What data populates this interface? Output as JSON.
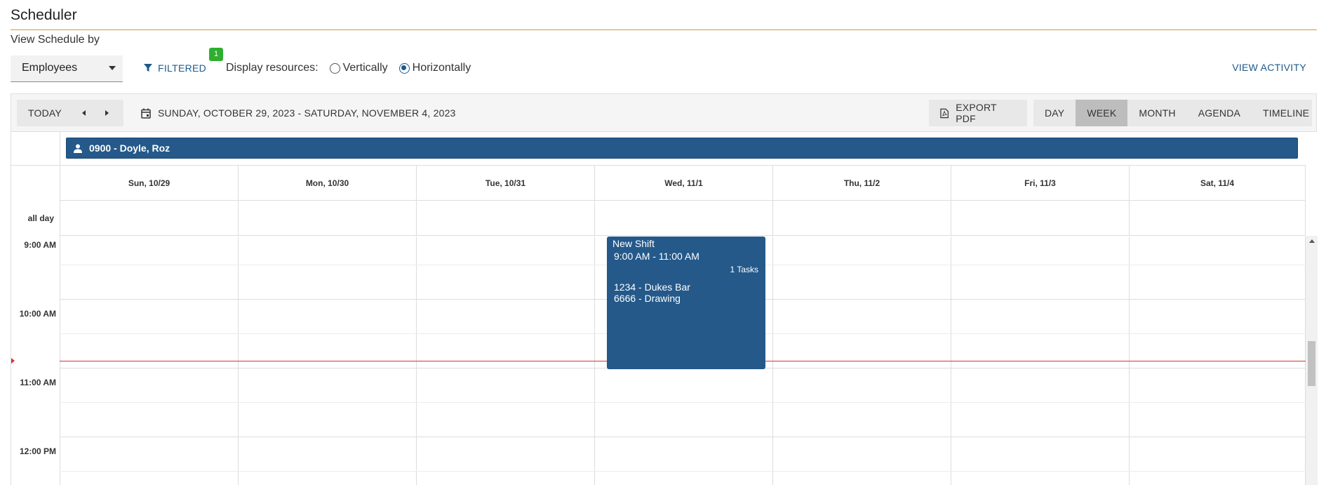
{
  "app": {
    "title": "Scheduler",
    "view_by_label": "View Schedule by"
  },
  "filters": {
    "view_by_selected": "Employees",
    "filtered_label": "FILTERED",
    "filter_count": "1",
    "display_resources_label": "Display resources:",
    "display_options": [
      {
        "label": "Vertically",
        "selected": false
      },
      {
        "label": "Horizontally",
        "selected": true
      }
    ],
    "view_activity_label": "VIEW ACTIVITY"
  },
  "toolbar": {
    "today_label": "TODAY",
    "date_range": "SUNDAY, OCTOBER 29, 2023 - SATURDAY, NOVEMBER 4, 2023",
    "export_pdf_label": "EXPORT PDF",
    "views": [
      "DAY",
      "WEEK",
      "MONTH",
      "AGENDA",
      "TIMELINE"
    ],
    "active_view": "WEEK"
  },
  "calendar": {
    "resource": "0900 - Doyle, Roz",
    "days": [
      "Sun, 10/29",
      "Mon, 10/30",
      "Tue, 10/31",
      "Wed, 11/1",
      "Thu, 11/2",
      "Fri, 11/3",
      "Sat, 11/4"
    ],
    "all_day_label": "all day",
    "times": [
      "9:00 AM",
      "10:00 AM",
      "11:00 AM",
      "12:00 PM"
    ],
    "event": {
      "title": "New Shift",
      "time": "9:00 AM - 11:00 AM",
      "tasks": "1 Tasks",
      "lines": [
        "1234 - Dukes Bar",
        "6666 - Drawing"
      ]
    }
  },
  "colors": {
    "accent": "#24598a",
    "link": "#1c5a8c",
    "badge": "#2fae2f",
    "now_line": "#e0302e",
    "title_rule": "#d49a3a"
  }
}
